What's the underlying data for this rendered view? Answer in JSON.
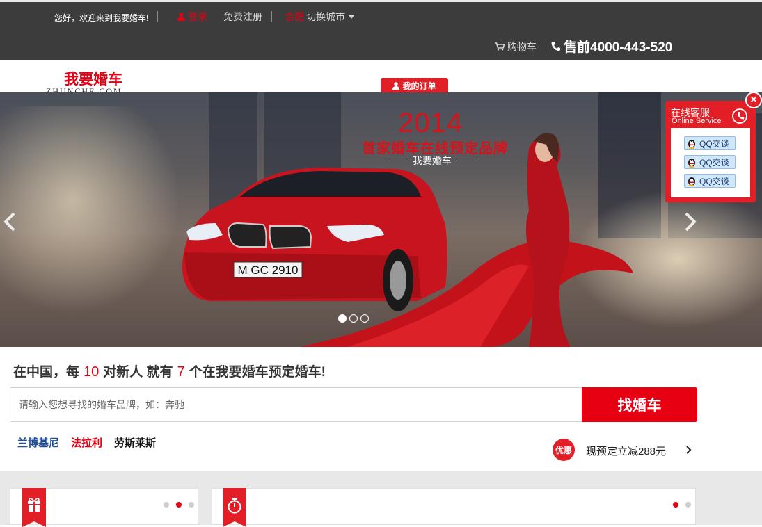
{
  "topbar": {
    "welcome": "您好，欢迎来到我要婚车!",
    "login": "登录",
    "register": "免费注册",
    "city": "合肥",
    "switch_city": "切换城市",
    "cart": "购物车",
    "hotline": "售前4000-443-520"
  },
  "header": {
    "logo": "我要婚车",
    "logo_sub": "ZHUNCHE.COM",
    "my_orders": "我的订单"
  },
  "banner": {
    "year": "2014",
    "slogan": "首家婚车在线预定品牌",
    "slogan_sub": "我要婚车",
    "slides": 3,
    "active_slide": 1
  },
  "service": {
    "title": "在线客服",
    "subtitle": "Online Service",
    "buttons": [
      "QQ交谈",
      "QQ交谈",
      "QQ交谈"
    ],
    "close": "×"
  },
  "stats": {
    "part1": "在中国，每",
    "num1": "10",
    "part2": "对新人 就有",
    "num2": "7",
    "part3": "个在我要婚车预定婚车!"
  },
  "search": {
    "placeholder": "请输入您想寻找的婚车品牌，如：奔驰",
    "button": "找婚车"
  },
  "brands": [
    {
      "label": "兰博基尼",
      "color": "#1f4e9c"
    },
    {
      "label": "法拉利",
      "color": "#e60012"
    },
    {
      "label": "劳斯莱斯",
      "color": "#111111"
    }
  ],
  "promo": {
    "badge": "优惠",
    "text": "现预定立减288元"
  },
  "colors": {
    "accent": "#e60012",
    "topbar": "#3c3c3c"
  },
  "icons": [
    "user-icon",
    "cart-icon",
    "phone-icon",
    "gift-icon",
    "stopwatch-icon",
    "qq-penguin-icon",
    "chevron-left-icon",
    "chevron-right-icon"
  ]
}
